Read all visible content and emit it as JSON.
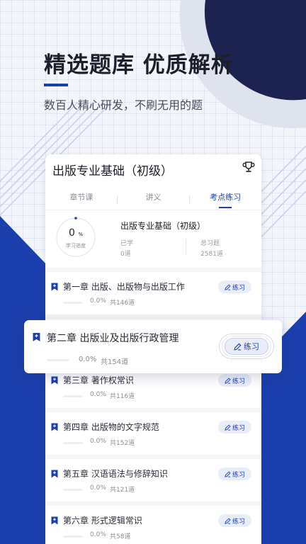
{
  "promo": {
    "headline": "精选题库 优质解析",
    "subline": "数百人精心研发，不刷无用的题"
  },
  "card": {
    "title": "出版专业基础（初级）",
    "tabs": [
      {
        "label": "章节课",
        "active": false
      },
      {
        "label": "讲义",
        "active": false
      },
      {
        "label": "考点练习",
        "active": true
      }
    ],
    "progress": {
      "value": "0",
      "unit": "%",
      "label": "学习进度",
      "fraction": 0
    },
    "stats": {
      "title": "出版专业基础（初级）",
      "learned_label": "已学",
      "learned_value": "0道",
      "total_label": "总习题",
      "total_value": "2581道"
    }
  },
  "practice_label": "练习",
  "chapters": [
    {
      "title": "第一章 出版、出版物与出版工作",
      "progress": "0.0%",
      "count": "共146道"
    },
    {
      "title": "第二章 出版业及出版行政管理",
      "progress": "0.0%",
      "count": "共154道"
    },
    {
      "title": "第三章 著作权常识",
      "progress": "0.0%",
      "count": "共116道"
    },
    {
      "title": "第四章 出版物的文字规范",
      "progress": "0.0%",
      "count": "共152道"
    },
    {
      "title": "第五章 汉语语法与修辞知识",
      "progress": "0.0%",
      "count": "共121道"
    },
    {
      "title": "第六章 形式逻辑常识",
      "progress": "0.0%",
      "count": "共58道"
    }
  ],
  "colors": {
    "brand": "#1c3fae",
    "background": "#f4f5fa"
  },
  "icons": {
    "trophy": "trophy-icon",
    "bookmark": "bookmark-plus-icon",
    "practice": "pen-icon"
  }
}
